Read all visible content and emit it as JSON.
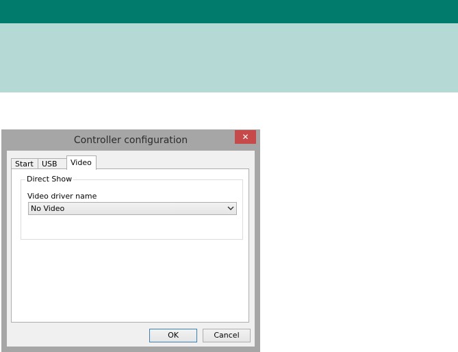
{
  "dialog": {
    "title": "Controller configuration",
    "close_glyph": "✕"
  },
  "tabs": [
    {
      "label": "Start",
      "active": false
    },
    {
      "label": "USB",
      "active": false
    },
    {
      "label": "Video",
      "active": true
    }
  ],
  "video_tab": {
    "group_label": "Direct Show",
    "field_label": "Video driver name",
    "selected_value": "No Video"
  },
  "buttons": {
    "ok": "OK",
    "cancel": "Cancel"
  },
  "colors": {
    "top_bar": "#007b6c",
    "sub_bar": "#b5dad6",
    "close_button": "#c74a4a",
    "dialog_frame": "#a6a6a6"
  }
}
